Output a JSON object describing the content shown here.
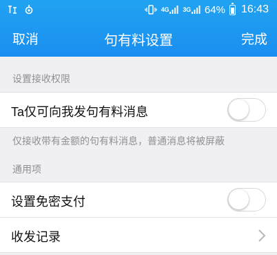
{
  "status_bar": {
    "carrier_icons": [
      "signal-icon",
      "settings-icon"
    ],
    "network_left": "4G",
    "network_right": "3G",
    "battery_percent": "64%",
    "battery_level": 0.64,
    "time": "16:43"
  },
  "nav": {
    "cancel": "取消",
    "title": "句有料设置",
    "done": "完成",
    "accent": "#1a8ef0"
  },
  "sections": {
    "receive_permission": {
      "header": "设置接收权限",
      "row_label": "Ta仅可向我发句有料消息",
      "toggle_on": false,
      "description": "仅接收带有金额的句有料消息，普通消息将被屏蔽"
    },
    "general": {
      "header": "通用项",
      "password_free_label": "设置免密支付",
      "password_free_on": false,
      "records_label": "收发记录"
    }
  }
}
